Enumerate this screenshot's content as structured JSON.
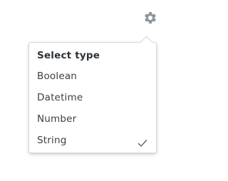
{
  "settings_button": {
    "icon": "gear-icon",
    "color": "#8e959c"
  },
  "type_menu": {
    "title": "Select type",
    "items": [
      {
        "label": "Boolean",
        "selected": false
      },
      {
        "label": "Datetime",
        "selected": false
      },
      {
        "label": "Number",
        "selected": false
      },
      {
        "label": "String",
        "selected": true
      }
    ],
    "check_icon": "checkmark-icon",
    "check_color": "#6e757c"
  }
}
